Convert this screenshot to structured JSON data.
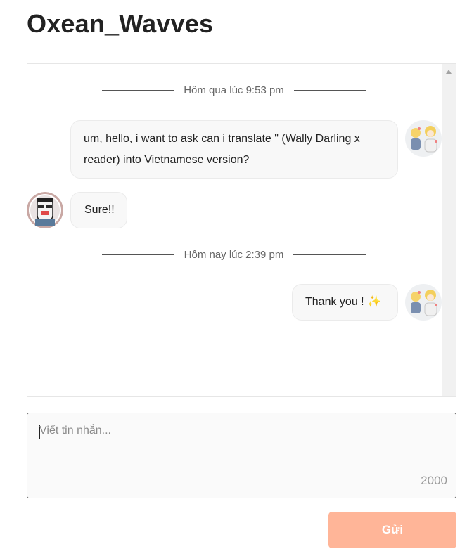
{
  "header": {
    "title": "Oxean_Wavves"
  },
  "conversation": {
    "groups": [
      {
        "date_label": "Hôm qua lúc 9:53 pm",
        "messages": [
          {
            "from": "me",
            "text": "um, hello, i want to ask can i translate \"  (Wally Darling x reader) into Vietnamese version?"
          },
          {
            "from": "other",
            "text": "Sure!!"
          }
        ]
      },
      {
        "date_label": "Hôm nay lúc 2:39 pm",
        "messages": [
          {
            "from": "me",
            "text": "Thank you !",
            "emoji": "✨"
          }
        ]
      }
    ]
  },
  "composer": {
    "placeholder": "Viết tin nhắn...",
    "char_limit": "2000",
    "send_label": "Gửi"
  },
  "icons": {
    "scroll_up": "chevron-up-icon",
    "sparkles": "sparkles-icon"
  },
  "colors": {
    "send_button": "#ffb598",
    "bubble_bg": "#f8f8f8",
    "scrollbar": "#f1f1f1"
  }
}
